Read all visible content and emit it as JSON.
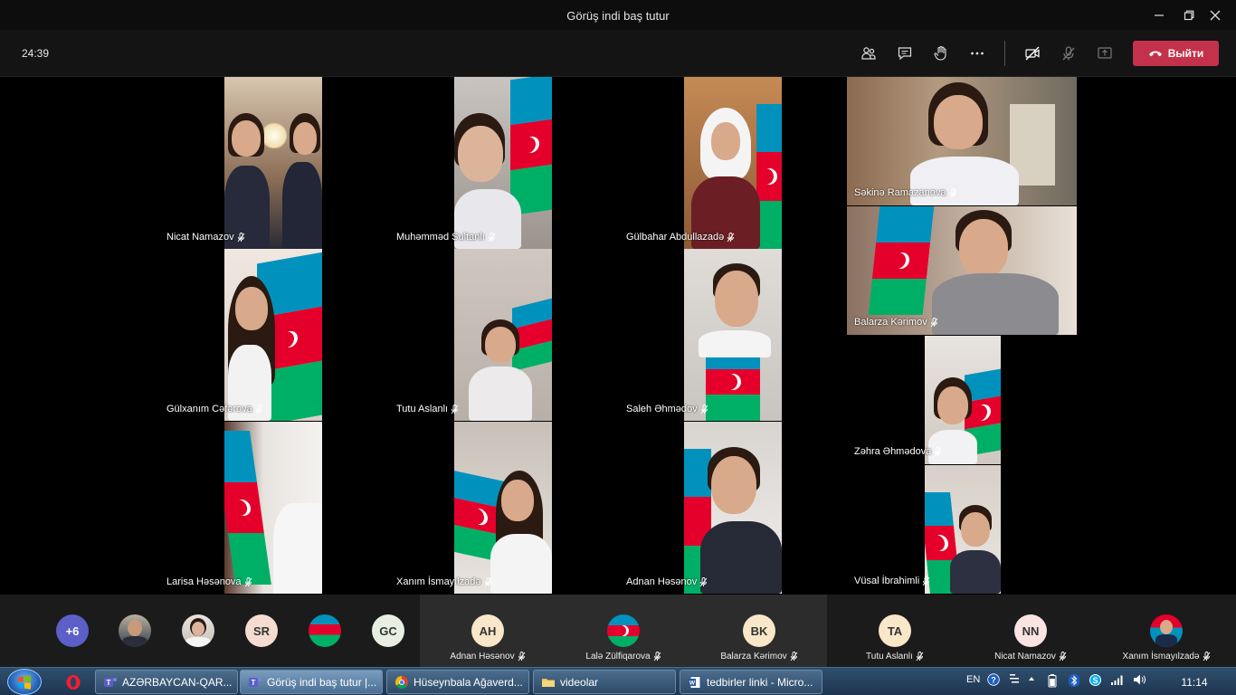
{
  "window": {
    "title": "Görüş indi baş tutur"
  },
  "meeting": {
    "timer": "24:39",
    "leave_label": "Выйти"
  },
  "tiles": [
    {
      "name": "Nicat Namazov"
    },
    {
      "name": "Muhəmməd Sultanlı"
    },
    {
      "name": "Gülbahar Abdullazadə"
    },
    {
      "name": "Səkinə Ramazanova"
    },
    {
      "name": "Gülxanım Cəfərova"
    },
    {
      "name": "Tutu Aslanlı"
    },
    {
      "name": "Saleh Əhmədov"
    },
    {
      "name": "Balarza Kərimov"
    },
    {
      "name": "Larisa Həsənova"
    },
    {
      "name": "Xanım İsmayılzadə"
    },
    {
      "name": "Adnan Həsənov"
    },
    {
      "name": "Zəhra Əhmədova"
    },
    {
      "name": "Vüsal İbrahimli"
    }
  ],
  "strip": {
    "overflow_count": "+6",
    "avatars": [
      "SR",
      "GC"
    ],
    "participants": [
      {
        "initials": "AH",
        "name": "Adnan Həsənov"
      },
      {
        "initials": "",
        "name": "Lalə Zülfiqarova"
      },
      {
        "initials": "BK",
        "name": "Balarza Kərimov"
      },
      {
        "initials": "TA",
        "name": "Tutu Aslanlı"
      },
      {
        "initials": "NN",
        "name": "Nicat Namazov"
      },
      {
        "initials": "",
        "name": "Xanım İsmayılzadə"
      }
    ]
  },
  "taskbar": {
    "items": [
      "AZƏRBAYCAN-QAR...",
      "Görüş indi baş tutur |...",
      "Hüseynbala Ağaverd...",
      "videolar",
      "tedbirler linki - Micro..."
    ],
    "language": "EN",
    "clock": "11:14"
  },
  "colors": {
    "leave_button": "#c4314b",
    "overflow_badge": "#5b5fc7",
    "avatar_bg": "#f4ddd0",
    "flag_blue": "#0092bc",
    "flag_red": "#e4002b",
    "flag_green": "#00af66"
  }
}
